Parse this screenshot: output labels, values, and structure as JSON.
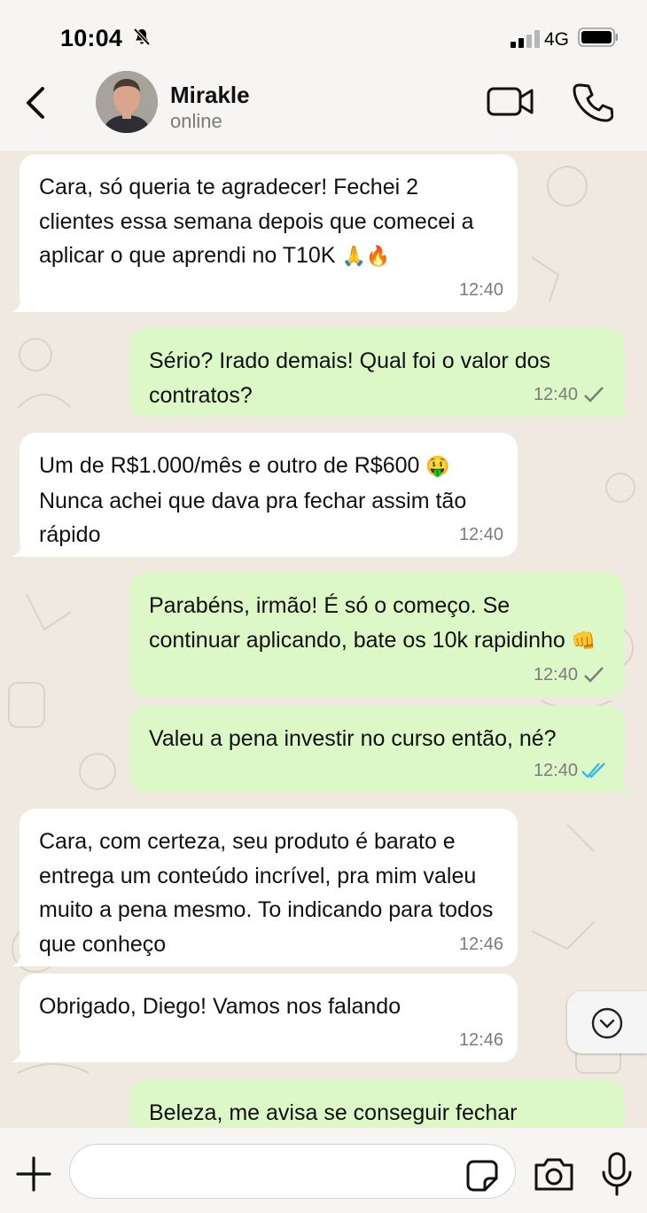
{
  "status_bar": {
    "time": "10:04",
    "network": "4G",
    "silent_icon": "bell-slash-icon"
  },
  "header": {
    "contact_name": "Mirakle",
    "contact_status": "online",
    "back_icon": "chevron-left-icon",
    "video_icon": "video-camera-icon",
    "call_icon": "phone-icon"
  },
  "messages": [
    {
      "direction": "in",
      "text": "Cara, só queria te agradecer! Fechei 2 clientes essa semana depois que comecei a aplicar o que aprendi no T10K",
      "emoji": "🙏🔥",
      "time": "12:40"
    },
    {
      "direction": "out",
      "text": "Sério? Irado demais! Qual foi o valor dos contratos?",
      "emoji": "",
      "time": "12:40",
      "status": "sent"
    },
    {
      "direction": "in",
      "text": "Um de R$1.000/mês e outro de R$600",
      "emoji": "🤑",
      "text2": "Nunca achei que dava pra fechar assim tão rápido",
      "time": "12:40"
    },
    {
      "direction": "out",
      "text": "Parabéns, irmão! É só o começo. Se continuar aplicando, bate os 10k rapidinho",
      "emoji": "👊",
      "time": "12:40",
      "status": "sent"
    },
    {
      "direction": "out",
      "text": "Valeu a pena investir no curso então, né?",
      "emoji": "",
      "time": "12:40",
      "status": "read"
    },
    {
      "direction": "in",
      "text": "Cara, com certeza, seu produto é barato e entrega um conteúdo incrível, pra mim valeu muito a pena mesmo. To indicando para todos que conheço",
      "emoji": "",
      "time": "12:46"
    },
    {
      "direction": "in",
      "text": "Obrigado, Diego! Vamos nos falando",
      "emoji": "",
      "time": "12:46"
    },
    {
      "direction": "out",
      "text": "Beleza, me avisa se conseguir fechar",
      "emoji": "",
      "time": "",
      "status": ""
    }
  ],
  "scroll_button_icon": "chevron-down-circle-icon",
  "composer": {
    "placeholder": "",
    "plus_icon": "plus-icon",
    "sticker_icon": "sticker-icon",
    "camera_icon": "camera-icon",
    "mic_icon": "microphone-icon"
  },
  "colors": {
    "incoming_bubble": "#ffffff",
    "outgoing_bubble": "#dcf8c6",
    "chat_background": "#efe9e1",
    "read_check": "#34b7f1",
    "sent_check": "#7c7c7c"
  }
}
